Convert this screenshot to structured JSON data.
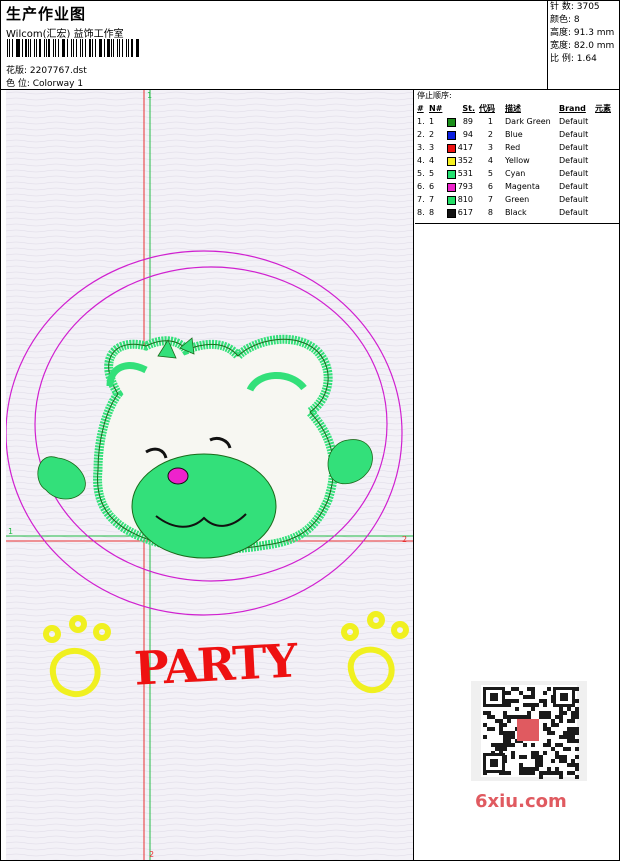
{
  "header": {
    "title": "生产作业图",
    "subtitle": "Wilcom(汇宏) 益饰工作室",
    "pattern_line": "花版: 2207767.dst",
    "color_line": "色 位:  Colorway 1"
  },
  "stats": [
    "针 数: 3705",
    "颜色: 8",
    "高度: 91.3 mm",
    "宽度: 82.0 mm",
    "比 例: 1.64"
  ],
  "stop_panel": {
    "title": "停止顺序:",
    "headers": [
      "#",
      "N#",
      "St.",
      "代码",
      "描述",
      "Brand",
      "元素"
    ],
    "rows": [
      {
        "n": "1.",
        "nn": "1",
        "color": "#1a8f1a",
        "st": "89",
        "code": "1",
        "desc": "Dark Green",
        "brand": "Default"
      },
      {
        "n": "2.",
        "nn": "2",
        "color": "#0a1ee0",
        "st": "94",
        "code": "2",
        "desc": "Blue",
        "brand": "Default"
      },
      {
        "n": "3.",
        "nn": "3",
        "color": "#ee1111",
        "st": "417",
        "code": "3",
        "desc": "Red",
        "brand": "Default"
      },
      {
        "n": "4.",
        "nn": "4",
        "color": "#f5f020",
        "st": "352",
        "code": "4",
        "desc": "Yellow",
        "brand": "Default"
      },
      {
        "n": "5.",
        "nn": "5",
        "color": "#22e070",
        "st": "531",
        "code": "5",
        "desc": "Cyan",
        "brand": "Default"
      },
      {
        "n": "6.",
        "nn": "6",
        "color": "#ee22cc",
        "st": "793",
        "code": "6",
        "desc": "Magenta",
        "brand": "Default"
      },
      {
        "n": "7.",
        "nn": "7",
        "color": "#22dd66",
        "st": "810",
        "code": "7",
        "desc": "Green",
        "brand": "Default"
      },
      {
        "n": "8.",
        "nn": "8",
        "color": "#111111",
        "st": "617",
        "code": "8",
        "desc": "Black",
        "brand": "Default"
      }
    ]
  },
  "design": {
    "text": "PARTY",
    "axis_labels": [
      "1",
      "2",
      "1",
      "2"
    ],
    "colors": {
      "guide_red": "#e83030",
      "guide_green": "#22bb44",
      "ring": "#d020d0",
      "bear": "#33e07a",
      "outline": "#1a6a1a",
      "paw": "#f0f020",
      "text": "#ee1111",
      "nose": "#ee22cc"
    }
  },
  "watermark": "6xiu.com"
}
